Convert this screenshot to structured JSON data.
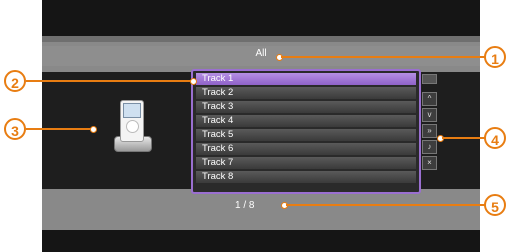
{
  "header": {
    "filter_label": "All"
  },
  "track_list": {
    "tracks": [
      "Track 1",
      "Track 2",
      "Track 3",
      "Track 4",
      "Track 5",
      "Track 6",
      "Track 7",
      "Track 8"
    ],
    "selected_index": 0
  },
  "side_controls": {
    "icons": [
      "page-up-icon",
      "chevron-up-icon",
      "chevron-down-icon",
      "page-down-icon",
      "music-note-icon",
      "close-icon"
    ],
    "glyphs": [
      "",
      "^",
      "v",
      "»",
      "♪",
      "×"
    ]
  },
  "pager": {
    "text": "1 / 8"
  },
  "callouts": {
    "c1": "1",
    "c2": "2",
    "c3": "3",
    "c4": "4",
    "c5": "5"
  },
  "colors": {
    "accent": "#e87d12",
    "selection": "#a57ad9",
    "background": "#898989"
  }
}
